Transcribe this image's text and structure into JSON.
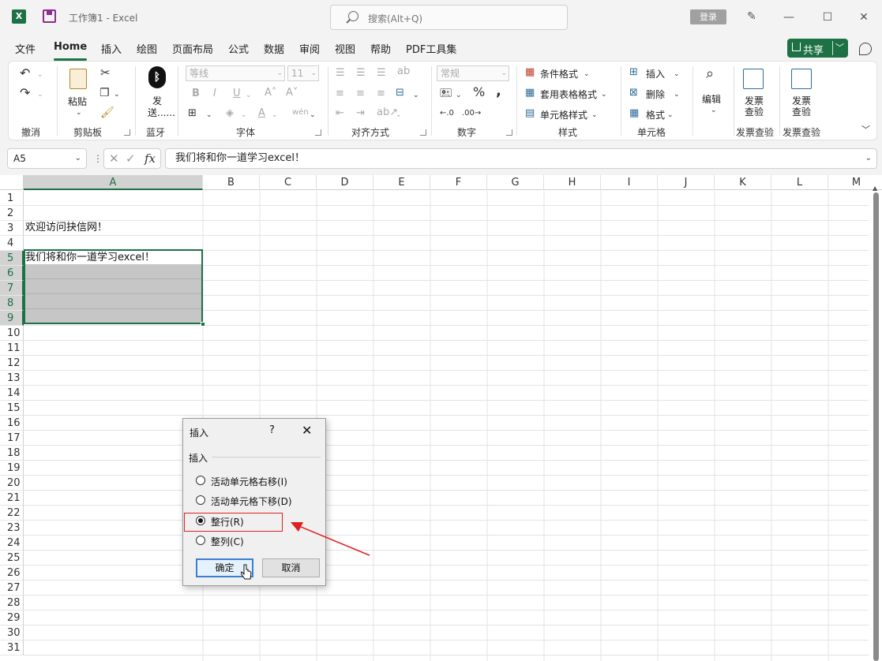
{
  "titlebar": {
    "app_icon": "X",
    "doc_title": "工作簿1  -  Excel",
    "search_placeholder": "搜索(Alt+Q)",
    "login": "登录",
    "icons": [
      "excel-icon",
      "save-icon",
      "search-icon",
      "pen-icon",
      "minimize-icon",
      "maximize-icon",
      "close-icon"
    ]
  },
  "tabs": [
    {
      "label": "文件"
    },
    {
      "label": "Home"
    },
    {
      "label": "插入"
    },
    {
      "label": "绘图"
    },
    {
      "label": "页面布局"
    },
    {
      "label": "公式"
    },
    {
      "label": "数据"
    },
    {
      "label": "审阅"
    },
    {
      "label": "视图"
    },
    {
      "label": "帮助"
    },
    {
      "label": "PDF工具集"
    }
  ],
  "share": {
    "label": "共享"
  },
  "ribbon": {
    "groups": {
      "undo": "撤消",
      "clipboard": "剪贴板",
      "bluetooth": "蓝牙",
      "font": "字体",
      "alignment": "对齐方式",
      "number": "数字",
      "styles": "样式",
      "cells": "单元格",
      "invoice1": "发票查验",
      "invoice2": "发票查验"
    },
    "paste": "粘贴",
    "send": "发",
    "send2": "送......",
    "font_name": "等线",
    "font_size": "11",
    "number_format": "常规",
    "conditional_format": "条件格式",
    "table_format": "套用表格格式",
    "cell_style": "单元格样式",
    "insert": "插入",
    "delete": "删除",
    "format": "格式",
    "edit": "编辑",
    "invoice_check1a": "发票",
    "invoice_check1b": "查验",
    "invoice_check2a": "发票",
    "invoice_check2b": "查验"
  },
  "formula_bar": {
    "name_box": "A5",
    "fx": "fx",
    "content": "我们将和你一道学习excel！"
  },
  "sheet": {
    "columns": [
      "A",
      "B",
      "C",
      "D",
      "E",
      "F",
      "G",
      "H",
      "I",
      "J",
      "K",
      "L",
      "M"
    ],
    "selected_column": "A",
    "rows": [
      "1",
      "2",
      "3",
      "4",
      "5",
      "6",
      "7",
      "8",
      "9",
      "10",
      "11",
      "12",
      "13",
      "14",
      "15",
      "16",
      "17",
      "18",
      "19",
      "20",
      "21",
      "22",
      "23",
      "24",
      "25",
      "26",
      "27",
      "28",
      "29",
      "30",
      "31"
    ],
    "selected_rows": [
      "5",
      "6",
      "7",
      "8",
      "9"
    ],
    "cells": {
      "A3": "欢迎访问抉信网！",
      "A5": "我们将和你一道学习excel！"
    }
  },
  "dialog": {
    "title": "插入",
    "help": "?",
    "close": "✕",
    "group": "插入",
    "options": [
      {
        "label": "活动单元格右移(I)",
        "checked": false
      },
      {
        "label": "活动单元格下移(D)",
        "checked": false
      },
      {
        "label": "整行(R)",
        "checked": true
      },
      {
        "label": "整列(C)",
        "checked": false
      }
    ],
    "ok": "确定",
    "cancel": "取消"
  },
  "colors": {
    "excel_green": "#1e7145",
    "annotation_red": "#e02020"
  }
}
